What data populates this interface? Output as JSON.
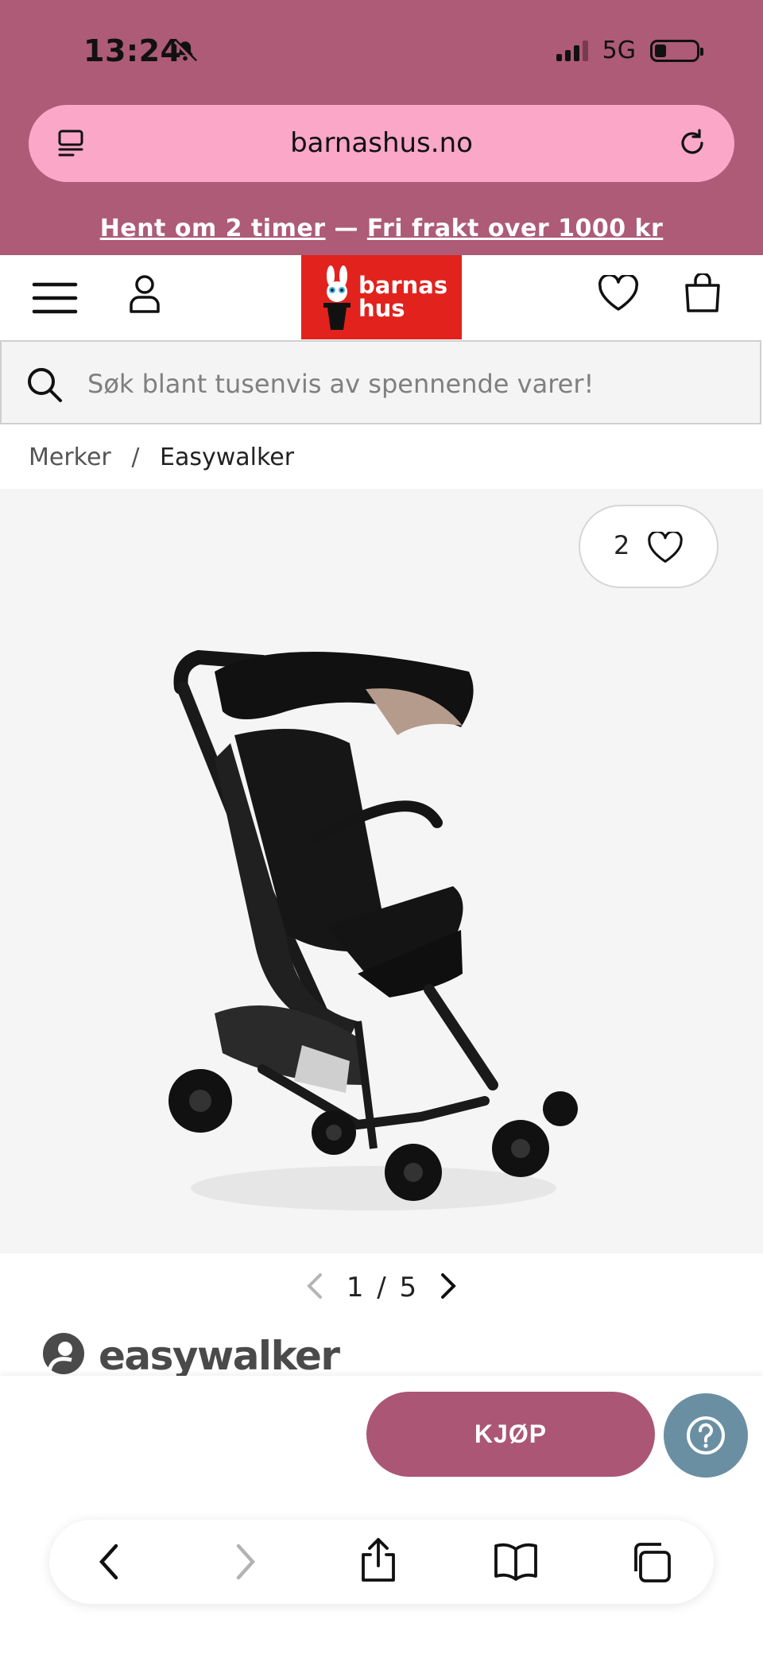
{
  "status_bar": {
    "time": "13:24",
    "network": "5G"
  },
  "browser": {
    "url": "barnashus.no"
  },
  "promo": {
    "link1": "Hent om 2 timer",
    "separator": " — ",
    "link2": "Fri frakt over 1000 kr"
  },
  "header": {
    "logo_line1": "barnas",
    "logo_line2": "hus"
  },
  "search": {
    "placeholder": "Søk blant tusenvis av spennende varer!"
  },
  "breadcrumb": {
    "root": "Merker",
    "separator": "/",
    "current": "Easywalker"
  },
  "gallery": {
    "favorite_count": "2",
    "pager_current": "1",
    "pager_sep": "/",
    "pager_total": "5"
  },
  "product": {
    "brand": "easywalker"
  },
  "actions": {
    "buy_label": "KJØP"
  },
  "colors": {
    "brand_band": "#ad5b77",
    "urlbar": "#fba7c8",
    "logo_red": "#e2221d",
    "buy": "#ab5674",
    "help": "#6a8fa3"
  }
}
